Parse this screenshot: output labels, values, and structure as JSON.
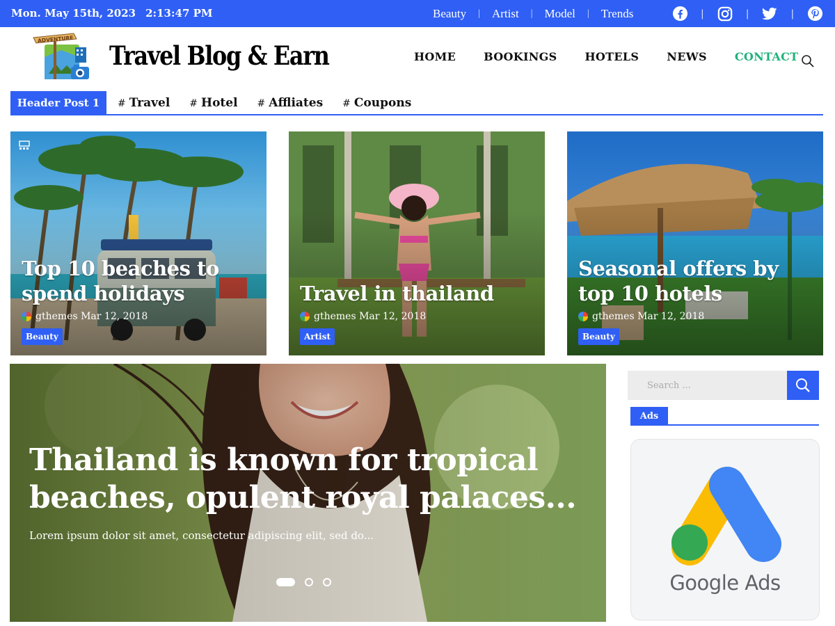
{
  "topbar": {
    "date": "Mon. May 15th, 2023",
    "time": "2:13:47 PM",
    "links": [
      "Beauty",
      "Artist",
      "Model",
      "Trends"
    ],
    "social_icons": [
      "facebook-icon",
      "instagram-icon",
      "twitter-icon",
      "pinterest-icon"
    ]
  },
  "header": {
    "logo_sign_text": "ADVENTURE",
    "site_title": "Travel Blog & Earn",
    "nav": [
      {
        "label": "HOME",
        "active": false
      },
      {
        "label": "BOOKINGS",
        "active": false
      },
      {
        "label": "HOTELS",
        "active": false
      },
      {
        "label": "NEWS",
        "active": false
      },
      {
        "label": "CONTACT",
        "active": true
      }
    ]
  },
  "tagbar": {
    "heading": "Header Post 1",
    "tags": [
      "Travel",
      "Hotel",
      "Affliates",
      "Coupons"
    ]
  },
  "cards": [
    {
      "title": "Top 10 beaches to spend holidays",
      "author": "gthemes",
      "date": "Mar 12, 2018",
      "category": "Beauty"
    },
    {
      "title": "Travel in thailand",
      "author": "gthemes",
      "date": "Mar 12, 2018",
      "category": "Artist"
    },
    {
      "title": "Seasonal offers by top 10 hotels",
      "author": "gthemes",
      "date": "Mar 12, 2018",
      "category": "Beauty"
    }
  ],
  "hero": {
    "title": "Thailand is known for tropical beaches, opulent royal palaces...",
    "excerpt": "Lorem ipsum dolor sit amet, consectetur adipiscing elit, sed do...",
    "slides_total": 3,
    "slide_active": 1
  },
  "sidebar": {
    "search_placeholder": "Search ...",
    "ads_heading": "Ads",
    "ad_text": "Google Ads"
  },
  "colors": {
    "accent": "#2f5ff4",
    "nav_active": "#20b27a"
  }
}
